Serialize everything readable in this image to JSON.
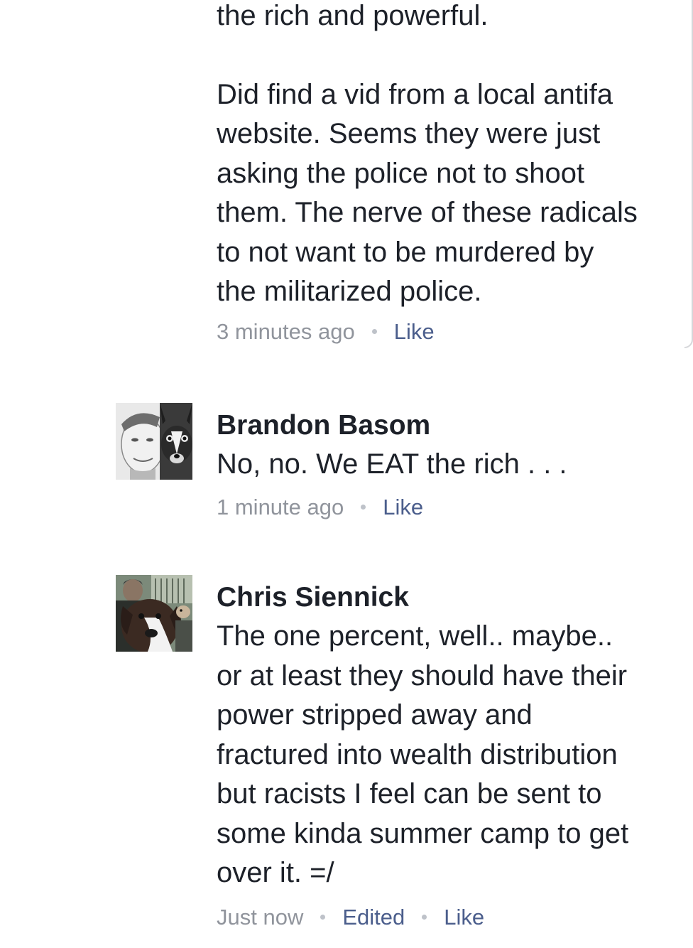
{
  "comments": [
    {
      "author": "",
      "text_top": "the rich and powerful.",
      "text": "Did find a vid from a local antifa\nwebsite. Seems they were just\nasking the police not to shoot\nthem. The nerve of these radicals\nto not want to be murdered by\nthe militarized police.",
      "time": "3 minutes ago",
      "like_label": "Like"
    },
    {
      "author": "Brandon Basom",
      "text": "No, no. We EAT the rich . . .",
      "time": "1 minute ago",
      "like_label": "Like",
      "avatar_icon": "user-avatar-man-with-dog"
    },
    {
      "author": "Chris Siennick",
      "text": "The one percent, well.. maybe..\nor at least they should have their\npower stripped away and\nfractured into wealth distribution\nbut racists I feel can be sent to\nsome kinda summer camp to get\nover it. =/",
      "time": "Just now",
      "edited_label": "Edited",
      "like_label": "Like",
      "avatar_icon": "user-avatar-dog-photo"
    }
  ],
  "colors": {
    "text": "#1d2129",
    "meta": "#90949c",
    "link": "#4b5e8c"
  }
}
